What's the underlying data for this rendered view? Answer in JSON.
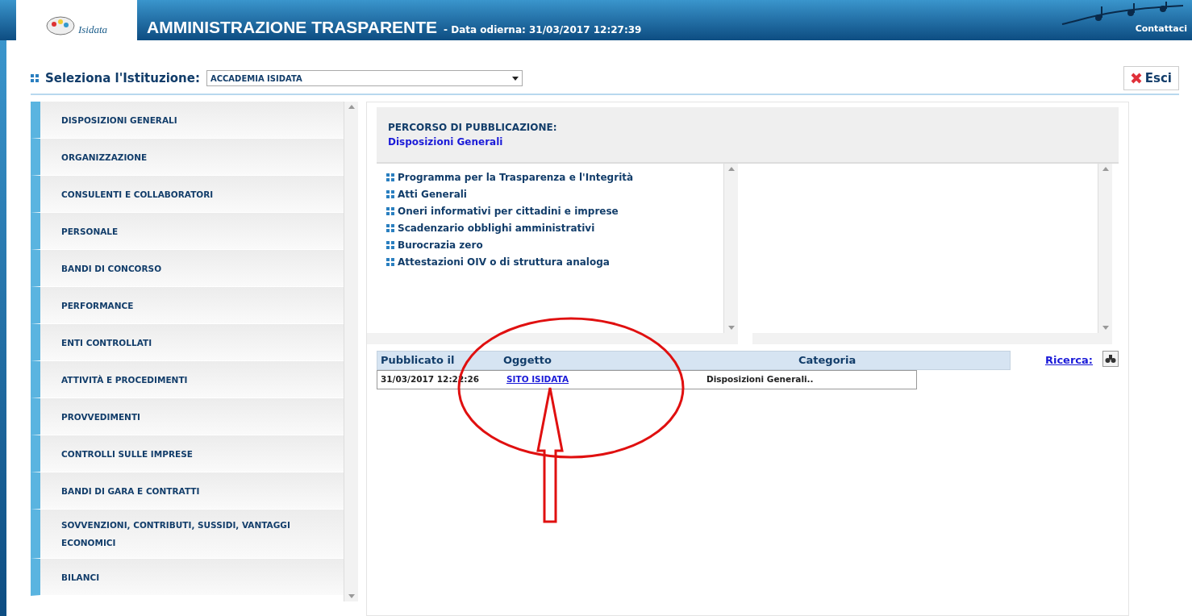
{
  "header": {
    "logo_text": "Isidata",
    "title": "AMMINISTRAZIONE TRASPARENTE",
    "date_text": "- Data odierna: 31/03/2017 12:27:39",
    "contact_link": "Contattaci"
  },
  "institution": {
    "label": "Seleziona l'Istituzione:",
    "value": "ACCADEMIA ISIDATA"
  },
  "exit_button": "Esci",
  "sidebar": {
    "items": [
      "DISPOSIZIONI GENERALI",
      "ORGANIZZAZIONE",
      "CONSULENTI E COLLABORATORI",
      "PERSONALE",
      "BANDI DI CONCORSO",
      "PERFORMANCE",
      "ENTI CONTROLLATI",
      "ATTIVITÀ E PROCEDIMENTI",
      "PROVVEDIMENTI",
      "CONTROLLI SULLE IMPRESE",
      "BANDI DI GARA E CONTRATTI",
      "SOVVENZIONI, CONTRIBUTI, SUSSIDI, VANTAGGI ECONOMICI",
      "BILANCI"
    ]
  },
  "path": {
    "heading": "PERCORSO DI PUBBLICAZIONE:",
    "current": "Disposizioni Generali"
  },
  "subsections": [
    "Programma per la Trasparenza e l'Integrità",
    "Atti Generali",
    "Oneri informativi per cittadini e imprese",
    "Scadenzario obblighi amministrativi",
    "Burocrazia zero",
    "Attestazioni OIV o di struttura analoga"
  ],
  "table": {
    "columns": [
      "Pubblicato il",
      "Oggetto",
      "Categoria"
    ],
    "rows": [
      {
        "published": "31/03/2017 12:22:26",
        "subject": "SITO ISIDATA",
        "category": "Disposizioni Generali.."
      }
    ]
  },
  "search_link": "Ricerca:"
}
